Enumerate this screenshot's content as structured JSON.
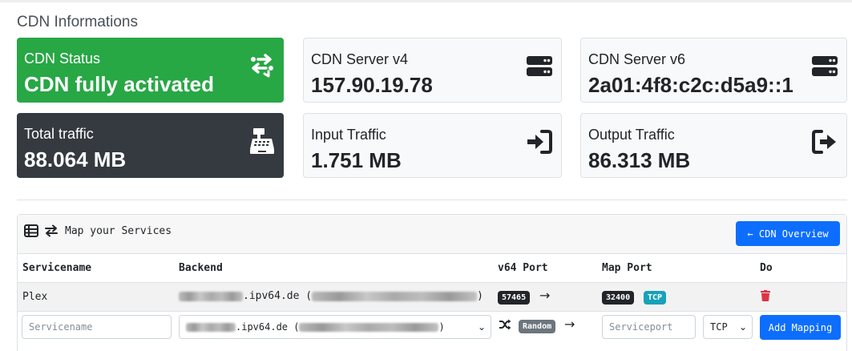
{
  "header": {
    "title": "CDN Informations"
  },
  "cards": {
    "status": {
      "label": "CDN Status",
      "value": "CDN fully activated",
      "icon": "exchange-icon",
      "color": "#28a745"
    },
    "server_v4": {
      "label": "CDN Server v4",
      "value": "157.90.19.78",
      "icon": "server-icon"
    },
    "server_v6": {
      "label": "CDN Server v6",
      "value": "2a01:4f8:c2c:d5a9::1",
      "icon": "server-icon"
    },
    "total": {
      "label": "Total traffic",
      "value": "88.064 MB",
      "icon": "cash-register-icon",
      "color": "#343a40"
    },
    "input": {
      "label": "Input Traffic",
      "value": "1.751 MB",
      "icon": "sign-in-icon"
    },
    "output": {
      "label": "Output Traffic",
      "value": "86.313 MB",
      "icon": "sign-out-icon"
    }
  },
  "services": {
    "title": "Map your Services",
    "overview_button": "← CDN Overview",
    "columns": [
      "Servicename",
      "Backend",
      "v64 Port",
      "Map Port",
      "Do"
    ],
    "rows": [
      {
        "servicename": "Plex",
        "backend_suffix": ".ipv64.de",
        "v64_port": "57465",
        "map_port": "32400",
        "protocol": "TCP"
      }
    ],
    "form": {
      "servicename_placeholder": "Servicename",
      "backend_suffix": ".ipv64.de",
      "v64_port_badge": "Random",
      "serviceport_placeholder": "Serviceport",
      "protocol": "TCP",
      "submit": "Add Mapping"
    }
  }
}
